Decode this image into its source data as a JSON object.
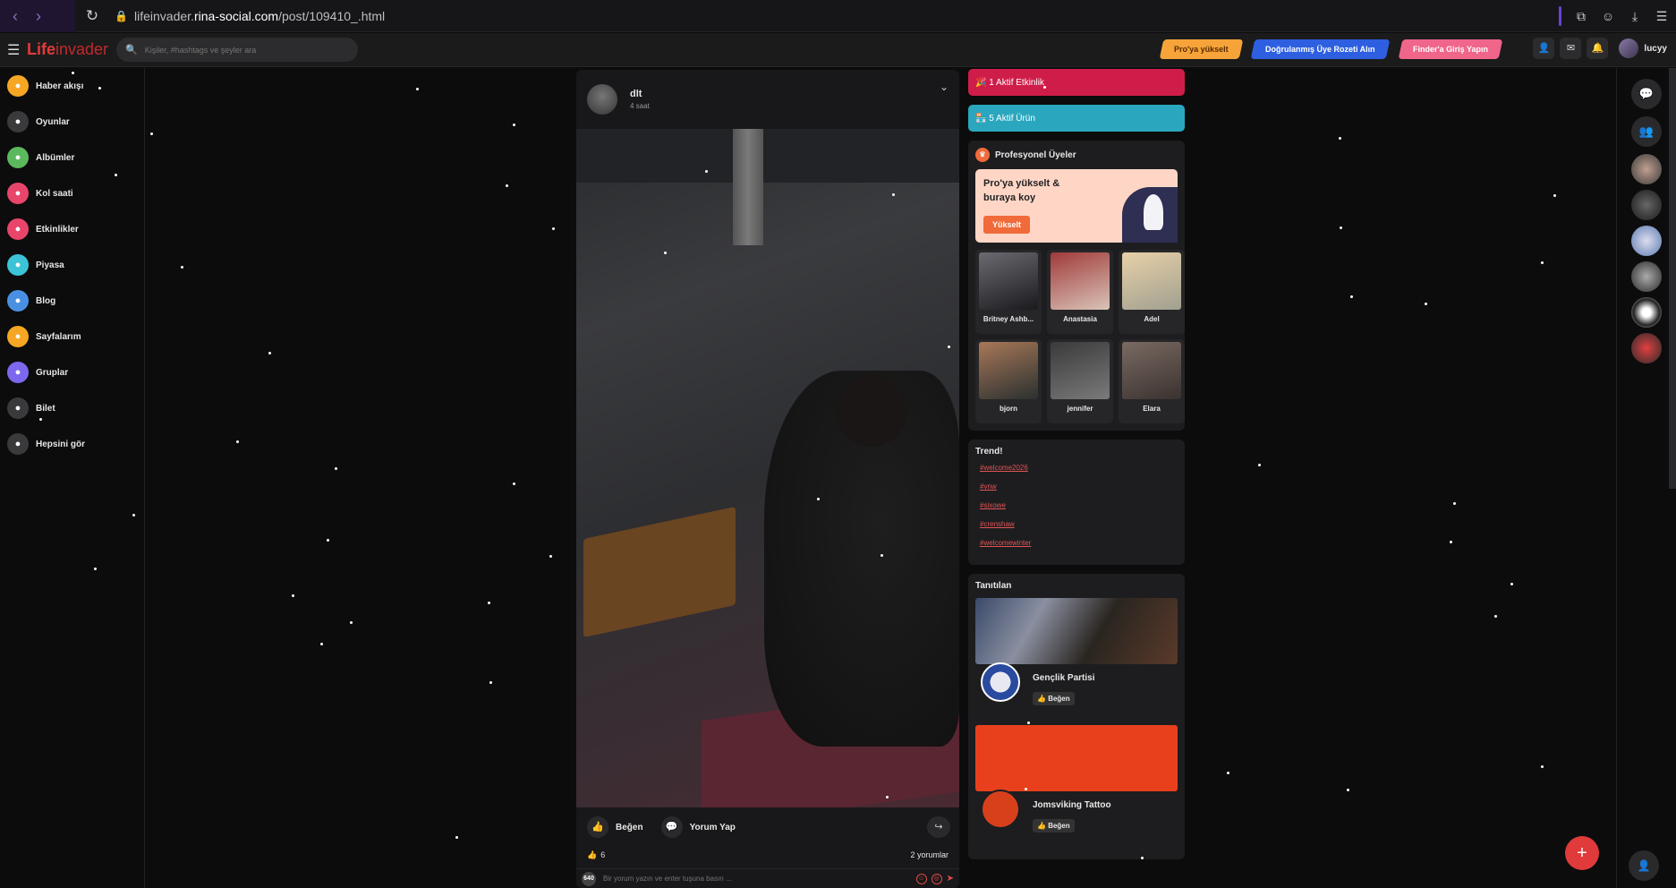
{
  "browser": {
    "url_prefix": "lifeinvader.",
    "url_domain": "rina-social.com",
    "url_path": "/post/109410_.html"
  },
  "topnav": {
    "logo_part1": "Life",
    "logo_part2": "invader",
    "search_placeholder": "Kişiler, #hashtags ve şeyler ara",
    "pills": [
      "Pro'ya yükselt",
      "Doğrulanmış Üye Rozeti Alın",
      "Finder'a Giriş Yapın"
    ],
    "username": "lucyy"
  },
  "sidebar": {
    "items": [
      {
        "label": "Haber akışı",
        "color": "#f5a623",
        "icon": "home-icon"
      },
      {
        "label": "Oyunlar",
        "color": "#3a3a3c",
        "icon": "gamepad-icon"
      },
      {
        "label": "Albümler",
        "color": "#5cb85c",
        "icon": "album-icon"
      },
      {
        "label": "Kol saati",
        "color": "#e9456b",
        "icon": "watch-icon"
      },
      {
        "label": "Etkinlikler",
        "color": "#e9456b",
        "icon": "calendar-icon"
      },
      {
        "label": "Piyasa",
        "color": "#3cc3d8",
        "icon": "market-icon"
      },
      {
        "label": "Blog",
        "color": "#4a90e2",
        "icon": "blog-icon"
      },
      {
        "label": "Sayfalarım",
        "color": "#f5a623",
        "icon": "flag-icon"
      },
      {
        "label": "Gruplar",
        "color": "#7b68ee",
        "icon": "group-icon"
      },
      {
        "label": "Bilet",
        "color": "#3a3a3c",
        "icon": "ticket-icon"
      },
      {
        "label": "Hepsini gör",
        "color": "#3a3a3c",
        "icon": "more-icon"
      }
    ]
  },
  "post": {
    "author": "dlt",
    "time": "4 saat",
    "like_label": "Beğen",
    "comment_label": "Yorum Yap",
    "like_count": "6",
    "comments_count": "2 yorumlar",
    "commenter_tag": "640",
    "comment_placeholder": "Bir yorum yazın ve enter tuşuna basın ..."
  },
  "right": {
    "active_events": "1 Aktif Etkinlik",
    "active_products": "5 Aktif Ürün",
    "pro_title": "Profesyonel Üyeler",
    "promo_text": "Pro'ya yükselt & buraya koy",
    "promo_button": "Yükselt",
    "members": [
      {
        "name": "Britney Ashb...",
        "c1": "#6a6a70",
        "c2": "#1a1a1e"
      },
      {
        "name": "Anastasia",
        "c1": "#a03a3a",
        "c2": "#d9c4b8"
      },
      {
        "name": "Adel",
        "c1": "#e8d0a8",
        "c2": "#a0a090"
      },
      {
        "name": "bjorn",
        "c1": "#a87858",
        "c2": "#2a3030"
      },
      {
        "name": "jennifer",
        "c1": "#3a3a3a",
        "c2": "#7a7a7a"
      },
      {
        "name": "Elara",
        "c1": "#7a6a62",
        "c2": "#3a3230"
      }
    ],
    "trend_title": "Trend!",
    "trends": [
      "#welcome2026",
      "#vnw",
      "#sixowe",
      "#crenshaw",
      "#welcomewinter"
    ],
    "featured_title": "Tanıtılan",
    "pages": [
      {
        "name": "Gençlik Partisi",
        "like": "Beğen"
      },
      {
        "name": "Jomsviking Tattoo",
        "like": "Beğen"
      }
    ]
  }
}
